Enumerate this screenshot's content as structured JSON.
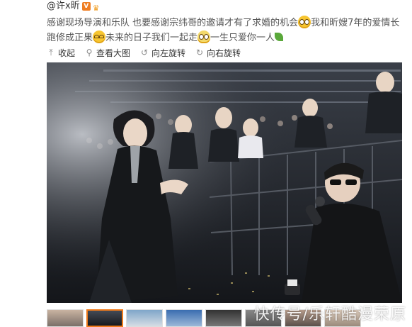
{
  "post": {
    "author": "@许x昕",
    "text_part1": "感谢现场导演和乐队 也要感谢宗纬哥的邀请才有了求婚的机会",
    "text_part2": "我和昕嫂7年的爱情长跑修成正果",
    "text_part3": "未来的日子我们一起走",
    "text_part4": "一生只爱你一人",
    "emoji_icons": [
      "grin-emoji-icon",
      "sad-emoji-icon",
      "blob-emoji-icon",
      "leaf-emoji-icon"
    ]
  },
  "toolbar": {
    "collapse": "收起",
    "view_large": "查看大图",
    "rotate_left": "向左旋转",
    "rotate_right": "向右旋转"
  },
  "thumbnails": {
    "count": 8,
    "active_index": 1
  },
  "watermark": "快传号/乐轩酷漫荣原",
  "colors": {
    "accent": "#f07a1a",
    "verified": "#ef7d21",
    "text": "#333333"
  }
}
